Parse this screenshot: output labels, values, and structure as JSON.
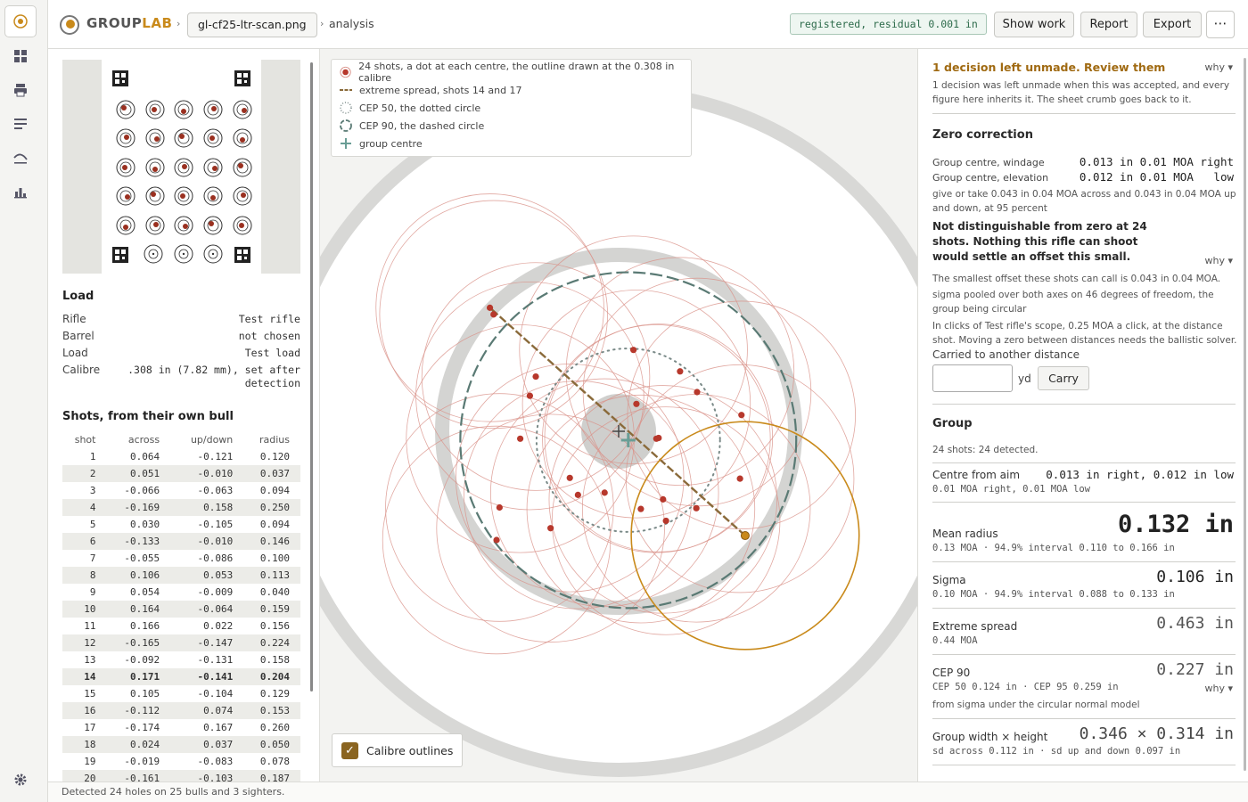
{
  "app": {
    "brand_a": "GROUP",
    "brand_b": "LAB"
  },
  "colors": {
    "accent": "#c98a1b",
    "shot": "#b7382c",
    "outline": "#d9928a",
    "cep90": "#5a7a74",
    "cep50": "#7a8a88",
    "extreme": "#8a6a3a",
    "status": "#2d6b4b"
  },
  "breadcrumb": {
    "file": "gl-cf25-ltr-scan.png",
    "view": "analysis",
    "sep": "›"
  },
  "status": "registered, residual 0.001 in",
  "toolbar": {
    "show_work": "Show work",
    "report": "Report",
    "export": "Export",
    "more": "⋯"
  },
  "rail": [
    "target-icon",
    "grid-icon",
    "print-icon",
    "list-icon",
    "curve-icon",
    "bar-chart-icon",
    "gear-icon"
  ],
  "load": {
    "title": "Load",
    "rows": [
      {
        "label": "Rifle",
        "value": "Test rifle"
      },
      {
        "label": "Barrel",
        "value": "not chosen"
      },
      {
        "label": "Load",
        "value": "Test load"
      },
      {
        "label": "Calibre",
        "value": ".308 in (7.82 mm), set after",
        "value2": "detection"
      }
    ]
  },
  "shots": {
    "title": "Shots, from their own bull",
    "headers": [
      "shot",
      "across",
      "up/down",
      "radius"
    ],
    "selected": 14,
    "rows": [
      [
        "1",
        "0.064",
        "-0.121",
        "0.120"
      ],
      [
        "2",
        "0.051",
        "-0.010",
        "0.037"
      ],
      [
        "3",
        "-0.066",
        "-0.063",
        "0.094"
      ],
      [
        "4",
        "-0.169",
        "0.158",
        "0.250"
      ],
      [
        "5",
        "0.030",
        "-0.105",
        "0.094"
      ],
      [
        "6",
        "-0.133",
        "-0.010",
        "0.146"
      ],
      [
        "7",
        "-0.055",
        "-0.086",
        "0.100"
      ],
      [
        "8",
        "0.106",
        "0.053",
        "0.113"
      ],
      [
        "9",
        "0.054",
        "-0.009",
        "0.040"
      ],
      [
        "10",
        "0.164",
        "-0.064",
        "0.159"
      ],
      [
        "11",
        "0.166",
        "0.022",
        "0.156"
      ],
      [
        "12",
        "-0.165",
        "-0.147",
        "0.224"
      ],
      [
        "13",
        "-0.092",
        "-0.131",
        "0.158"
      ],
      [
        "14",
        "0.171",
        "-0.141",
        "0.204"
      ],
      [
        "15",
        "0.105",
        "-0.104",
        "0.129"
      ],
      [
        "16",
        "-0.112",
        "0.074",
        "0.153"
      ],
      [
        "17",
        "-0.174",
        "0.167",
        "0.260"
      ],
      [
        "18",
        "0.024",
        "0.037",
        "0.050"
      ],
      [
        "19",
        "-0.019",
        "-0.083",
        "0.078"
      ],
      [
        "20",
        "-0.161",
        "-0.103",
        "0.187"
      ]
    ]
  },
  "legend": {
    "shots": "24 shots, a dot at each centre, the outline drawn at the 0.308 in calibre",
    "extreme": "extreme spread, shots 14 and 17",
    "cep50": "CEP 50, the dotted circle",
    "cep90": "CEP 90, the dashed circle",
    "centre": "group centre"
  },
  "toggle": {
    "label": "Calibre outlines",
    "checked": true
  },
  "decision": {
    "title": "1 decision left unmade. Review them",
    "why": "why ▾",
    "body": "1 decision was left unmade when this was accepted, and every figure here inherits it. The sheet crumb goes back to it."
  },
  "zero": {
    "title": "Zero correction",
    "windage_label": "Group centre, windage",
    "windage_value": "0.013 in 0.01 MOA right",
    "elevation_label": "Group centre, elevation",
    "elevation_value": "0.012 in 0.01 MOA   low",
    "giveortake": "give or take 0.043 in  0.04 MOA across and 0.043 in  0.04 MOA up and down, at 95 percent",
    "verdict": "Not distinguishable from zero at 24 shots. Nothing this rifle can shoot would settle an offset this small.",
    "why": "why ▾",
    "smallest": "The smallest offset these shots can call is 0.043 in  0.04 MOA.",
    "sigma": "sigma pooled over both axes on 46 degrees of freedom, the group being circular",
    "clicks": "In clicks of Test rifle's scope, 0.25 MOA a click, at the distance shot. Moving a zero between distances needs the ballistic solver.",
    "carry_label": "Carried to another distance",
    "carry_value": "",
    "carry_unit": "yd",
    "carry_button": "Carry"
  },
  "group": {
    "title": "Group",
    "detected": "24 shots: 24 detected.",
    "centre_label": "Centre from aim",
    "centre_value": "0.013 in right, 0.012 in low",
    "centre_sub": "0.01 MOA right, 0.01 MOA low",
    "mean_label": "Mean radius",
    "mean_value": "0.132 in",
    "mean_sub": "0.13 MOA  ·  94.9% interval 0.110 to 0.166 in",
    "sigma_label": "Sigma",
    "sigma_value": "0.106 in",
    "sigma_sub": "0.10 MOA  ·  94.9% interval 0.088 to 0.133 in",
    "es_label": "Extreme spread",
    "es_value": "0.463 in",
    "es_sub": "0.44 MOA",
    "cep_label": "CEP 90",
    "cep_value": "0.227 in",
    "cep_sub": "CEP 50 0.124 in  ·  CEP 95 0.259 in",
    "cep_why": "why ▾",
    "cep_note": "from sigma under the circular normal model",
    "wh_label": "Group width × height",
    "wh_value": "0.346 × 0.314 in",
    "wh_sub": "sd across 0.112 in  ·  sd up and down 0.097 in"
  },
  "footer": "Detected 24 holes on 25 bulls and 3 sighters.",
  "chart_data": {
    "type": "scatter",
    "units": "in",
    "calibre": 0.308,
    "cep50": 0.124,
    "cep90": 0.227,
    "group_centre": [
      0.013,
      -0.012
    ],
    "extreme_pair": [
      14,
      17
    ],
    "points": [
      {
        "shot": 1,
        "x": 0.064,
        "y": -0.121
      },
      {
        "shot": 2,
        "x": 0.051,
        "y": -0.01
      },
      {
        "shot": 3,
        "x": -0.066,
        "y": -0.063
      },
      {
        "shot": 4,
        "x": -0.169,
        "y": 0.158
      },
      {
        "shot": 5,
        "x": 0.03,
        "y": -0.105
      },
      {
        "shot": 6,
        "x": -0.133,
        "y": -0.01
      },
      {
        "shot": 7,
        "x": -0.055,
        "y": -0.086
      },
      {
        "shot": 8,
        "x": 0.106,
        "y": 0.053
      },
      {
        "shot": 9,
        "x": 0.054,
        "y": -0.009
      },
      {
        "shot": 10,
        "x": 0.164,
        "y": -0.064
      },
      {
        "shot": 11,
        "x": 0.166,
        "y": 0.022
      },
      {
        "shot": 12,
        "x": -0.165,
        "y": -0.147
      },
      {
        "shot": 13,
        "x": -0.092,
        "y": -0.131
      },
      {
        "shot": 14,
        "x": 0.171,
        "y": -0.141
      },
      {
        "shot": 15,
        "x": 0.105,
        "y": -0.104
      },
      {
        "shot": 16,
        "x": -0.112,
        "y": 0.074
      },
      {
        "shot": 17,
        "x": -0.174,
        "y": 0.167
      },
      {
        "shot": 18,
        "x": 0.024,
        "y": 0.037
      },
      {
        "shot": 19,
        "x": -0.019,
        "y": -0.083
      },
      {
        "shot": 20,
        "x": -0.161,
        "y": -0.103
      },
      {
        "shot": 21,
        "x": 0.02,
        "y": 0.11
      },
      {
        "shot": 22,
        "x": 0.083,
        "y": 0.081
      },
      {
        "shot": 23,
        "x": 0.06,
        "y": -0.092
      },
      {
        "shot": 24,
        "x": -0.12,
        "y": 0.048
      }
    ]
  }
}
